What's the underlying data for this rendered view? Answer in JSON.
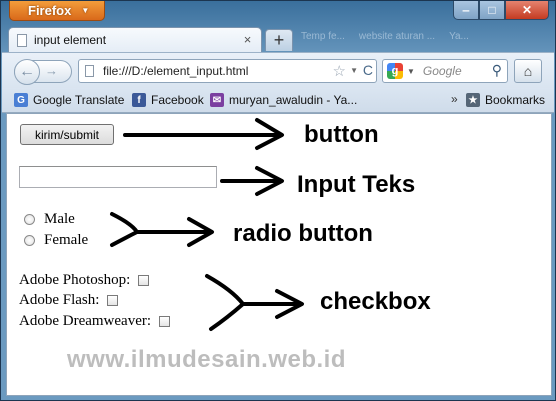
{
  "window": {
    "app_button": "Firefox",
    "controls": {
      "minimize": "‒",
      "maximize": "□",
      "close": "✕"
    }
  },
  "tabs": {
    "active": {
      "title": "input element",
      "close": "×"
    },
    "new_tab": "+",
    "background_tabs": [
      "Temp fe...",
      "website aturan ...",
      "Ya..."
    ]
  },
  "navbar": {
    "back": "←",
    "forward": "→",
    "url": "file:///D:/element_input.html",
    "star": "☆",
    "reload": "C",
    "search_engine_letter": "g",
    "search_placeholder": "Google",
    "search_button": "⚲",
    "home": "⌂"
  },
  "bookmarks": {
    "items": [
      {
        "label": "Google Translate",
        "icon": "G"
      },
      {
        "label": "Facebook",
        "icon": "f"
      },
      {
        "label": "muryan_awaludin - Ya...",
        "icon": "✉"
      }
    ],
    "overflow": "»",
    "bookmarks_menu": {
      "label": "Bookmarks",
      "icon": "★"
    }
  },
  "page": {
    "submit_label": "kirim/submit",
    "text_input_value": "",
    "radio_options": [
      "Male",
      "Female"
    ],
    "checkbox_options": [
      "Adobe Photoshop:",
      "Adobe Flash:",
      "Adobe Dreamweaver:"
    ],
    "annotations": {
      "button": "button",
      "input": "Input Teks",
      "radio": "radio button",
      "checkbox": "checkbox"
    },
    "watermark": "www.ilmudesain.web.id"
  }
}
